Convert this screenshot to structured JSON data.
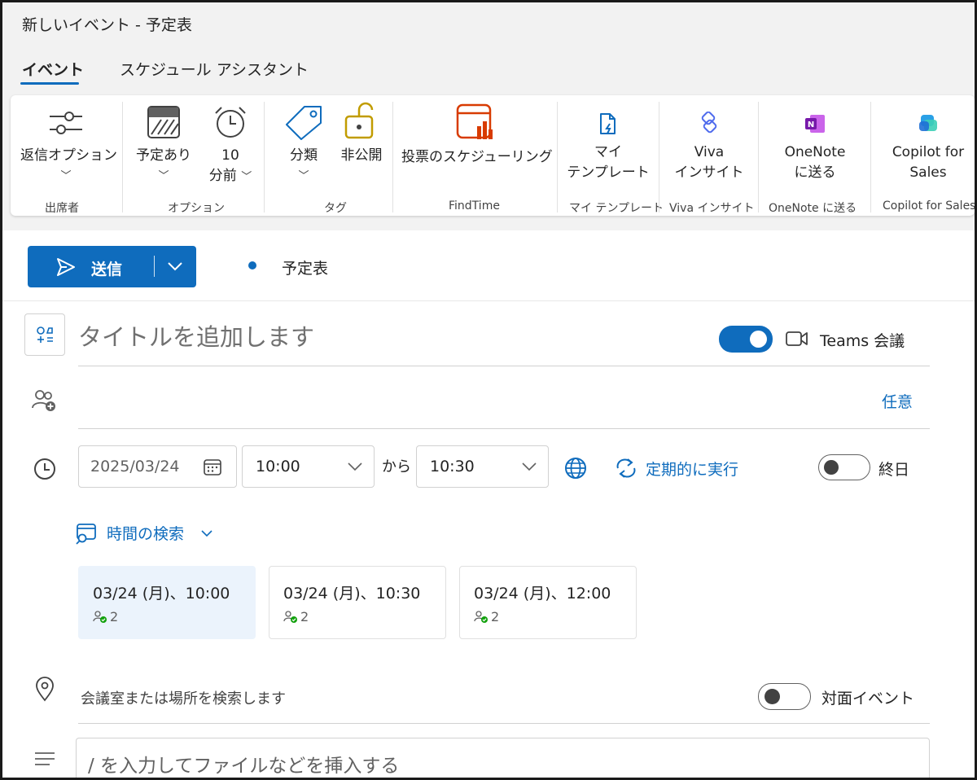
{
  "window": {
    "title": "新しいイベント - 予定表"
  },
  "tabs": [
    {
      "label": "イベント",
      "active": true
    },
    {
      "label": "スケジュール アシスタント",
      "active": false
    }
  ],
  "ribbon": {
    "groups": [
      {
        "label": "出席者",
        "buttons": [
          {
            "label": "返信オプション",
            "icon": "reply-options-icon"
          }
        ]
      },
      {
        "label": "オプション",
        "buttons": [
          {
            "label": "予定あり",
            "icon": "busy-status-icon"
          },
          {
            "label_line1": "10",
            "label_line2": "分前",
            "icon": "alarm-clock-icon"
          }
        ]
      },
      {
        "label": "タグ",
        "buttons": [
          {
            "label": "分類",
            "icon": "tag-icon"
          },
          {
            "label": "非公開",
            "icon": "lock-icon"
          }
        ]
      },
      {
        "label": "FindTime",
        "buttons": [
          {
            "label": "投票のスケジューリング",
            "icon": "findtime-icon"
          }
        ]
      },
      {
        "label": "マイ テンプレート",
        "buttons": [
          {
            "label_line1": "マイ",
            "label_line2": "テンプレート",
            "icon": "template-icon"
          }
        ]
      },
      {
        "label": "Viva インサイト",
        "buttons": [
          {
            "label_line1": "Viva",
            "label_line2": "インサイト",
            "icon": "viva-insights-icon"
          }
        ]
      },
      {
        "label": "OneNote に送る",
        "buttons": [
          {
            "label_line1": "OneNote",
            "label_line2": "に送る",
            "icon": "onenote-icon"
          }
        ]
      },
      {
        "label": "Copilot for Sales",
        "buttons": [
          {
            "label_line1": "Copilot for",
            "label_line2": "Sales",
            "icon": "copilot-icon"
          }
        ]
      }
    ]
  },
  "compose": {
    "send_label": "送信",
    "calendar_name": "予定表",
    "calendar_color": "#0f6cbd",
    "title_placeholder": "タイトルを追加します",
    "teams_label": "Teams 会議",
    "teams_on": true,
    "optional_label": "任意",
    "date": "2025/03/24",
    "start_time": "10:00",
    "from_label": "から",
    "end_time": "10:30",
    "recurring_label": "定期的に実行",
    "all_day_label": "終日",
    "all_day_on": false,
    "find_time_label": "時間の検索",
    "suggestions": [
      {
        "label": "03/24 (月)、10:00",
        "count": "2",
        "selected": true
      },
      {
        "label": "03/24 (月)、10:30",
        "count": "2",
        "selected": false
      },
      {
        "label": "03/24 (月)、12:00",
        "count": "2",
        "selected": false
      }
    ],
    "location_placeholder": "会議室または場所を検索します",
    "in_person_label": "対面イベント",
    "in_person_on": false,
    "body_placeholder": "/ を入力してファイルなどを挿入する"
  },
  "colors": {
    "accent": "#0f6cbd",
    "ribbon_bg": "#f2f2f2",
    "selected_slot": "#ebf3fc"
  }
}
